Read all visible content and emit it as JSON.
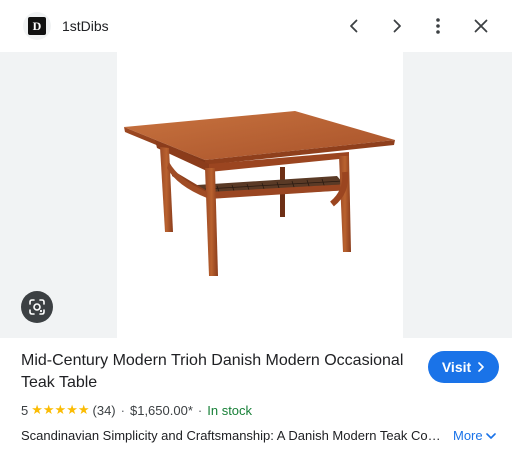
{
  "header": {
    "site_name": "1stDibs",
    "logo_letter": "D",
    "icons": [
      "chevron-left-icon",
      "chevron-right-icon",
      "more-vert-icon",
      "close-icon"
    ]
  },
  "image": {
    "subject": "teak-table-image",
    "lens_icon": "google-lens-icon"
  },
  "product": {
    "title": "Mid-Century Modern Trioh Danish Modern Occasional Teak Table",
    "visit_label": "Visit",
    "rating": "5",
    "stars": "★★★★★",
    "reviews": "(34)",
    "separator": "·",
    "price": "$1,650.00*",
    "stock": "In stock",
    "description": "Scandinavian Simplicity and Craftsmanship: A Danish Modern Teak Coffee…",
    "more_label": "More"
  },
  "colors": {
    "accent": "#1a73e8",
    "stock_green": "#188038",
    "star_yellow": "#fbbc04",
    "image_bg": "#f1f3f4"
  }
}
